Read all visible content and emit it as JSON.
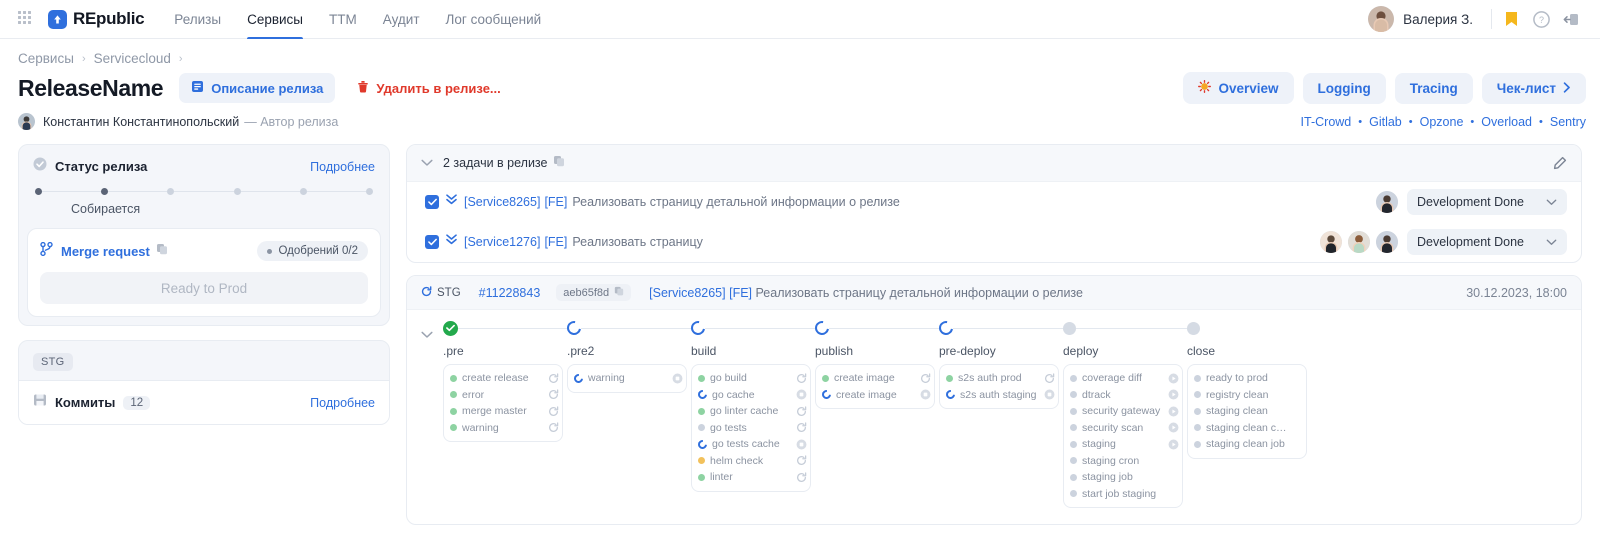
{
  "topnav": {
    "grid_icon": "apps-grid-icon",
    "brand": "REpublic",
    "links": [
      {
        "label": "Релизы",
        "active": false
      },
      {
        "label": "Сервисы",
        "active": true
      },
      {
        "label": "TTM",
        "active": false
      },
      {
        "label": "Аудит",
        "active": false
      },
      {
        "label": "Лог сообщений",
        "active": false
      }
    ],
    "user": "Валерия З.",
    "icons": [
      "bookmark-icon",
      "help-icon",
      "logout-icon"
    ]
  },
  "breadcrumb": {
    "items": [
      "Сервисы",
      "Servicecloud"
    ],
    "separator": "›"
  },
  "title": {
    "name": "ReleaseName",
    "description_button": "Описание релиза",
    "delete_button": "Удалить в релизе...",
    "tabs": [
      {
        "label": "Overview",
        "icon": "sun-icon"
      },
      {
        "label": "Logging",
        "icon": ""
      },
      {
        "label": "Tracing",
        "icon": ""
      },
      {
        "label": "Чек-лист",
        "icon": "chevron-right-icon"
      }
    ]
  },
  "author": {
    "name": "Константин Константинопольский",
    "role": "— Автор релиза",
    "links": [
      "IT-Crowd",
      "Gitlab",
      "Opzone",
      "Overload",
      "Sentry"
    ],
    "separator": "•"
  },
  "status_card": {
    "title": "Статус релиза",
    "more": "Подробнее",
    "progress_nodes": [
      true,
      true,
      false,
      false,
      false,
      false
    ],
    "progress_label": "Собирается",
    "merge_request": "Merge request",
    "approvals": "Одобрений 0/2",
    "ready_button": "Ready to Prod"
  },
  "commits_card": {
    "tag": "STG",
    "title": "Коммиты",
    "count": "12",
    "more": "Подробнее"
  },
  "tasks": {
    "header": "2 задачи в релизе",
    "edit_icon": "pencil-icon",
    "rows": [
      {
        "key": "[Service8265]",
        "fe": "[FE]",
        "text": "Реализовать страницу детальной информации о релизе",
        "avatars": 1,
        "status": "Development Done"
      },
      {
        "key": "[Service1276]",
        "fe": "[FE]",
        "text": "Реализовать страницу",
        "avatars": 3,
        "status": "Development Done"
      }
    ]
  },
  "pipeline": {
    "env": "STG",
    "id": "#11228843",
    "sha": "aeb65f8d",
    "task_key": "[Service8265]",
    "task_fe": "[FE]",
    "task_text": "Реализовать страницу детальной информации о релизе",
    "date": "30.12.2023, 18:00",
    "stages": [
      {
        "label": ".pre",
        "state": "success",
        "jobs": [
          {
            "name": "create release",
            "status": "green",
            "action": "retry"
          },
          {
            "name": "error",
            "status": "green",
            "action": "retry"
          },
          {
            "name": "merge master",
            "status": "green",
            "action": "retry"
          },
          {
            "name": "warning",
            "status": "green",
            "action": "retry"
          }
        ]
      },
      {
        "label": ".pre2",
        "state": "running",
        "jobs": [
          {
            "name": "warning",
            "status": "running",
            "action": "cancel"
          }
        ]
      },
      {
        "label": "build",
        "state": "running",
        "jobs": [
          {
            "name": "go build",
            "status": "green",
            "action": "retry"
          },
          {
            "name": "go cache",
            "status": "running",
            "action": "cancel"
          },
          {
            "name": "go linter cache",
            "status": "green",
            "action": "retry"
          },
          {
            "name": "go tests",
            "status": "grey",
            "action": "retry"
          },
          {
            "name": "go tests cache",
            "status": "running",
            "action": "cancel"
          },
          {
            "name": "helm check",
            "status": "amber",
            "action": "retry"
          },
          {
            "name": "linter",
            "status": "green",
            "action": "retry"
          }
        ]
      },
      {
        "label": "publish",
        "state": "running",
        "jobs": [
          {
            "name": "create image",
            "status": "green",
            "action": "retry"
          },
          {
            "name": "create image",
            "status": "running",
            "action": "cancel"
          }
        ]
      },
      {
        "label": "pre-deploy",
        "state": "running",
        "jobs": [
          {
            "name": "s2s auth prod",
            "status": "green",
            "action": "retry"
          },
          {
            "name": "s2s auth staging",
            "status": "running",
            "action": "cancel"
          }
        ]
      },
      {
        "label": "deploy",
        "state": "idle",
        "jobs": [
          {
            "name": "coverage diff",
            "status": "grey",
            "action": "play"
          },
          {
            "name": "dtrack",
            "status": "grey",
            "action": "play"
          },
          {
            "name": "security gateway",
            "status": "grey",
            "action": "play"
          },
          {
            "name": "security scan",
            "status": "grey",
            "action": "play"
          },
          {
            "name": "staging",
            "status": "grey",
            "action": "play"
          },
          {
            "name": "staging cron",
            "status": "grey",
            "action": ""
          },
          {
            "name": "staging job",
            "status": "grey",
            "action": ""
          },
          {
            "name": "start job staging",
            "status": "grey",
            "action": ""
          }
        ]
      },
      {
        "label": "close",
        "state": "idle",
        "jobs": [
          {
            "name": "ready to prod",
            "status": "grey",
            "action": ""
          },
          {
            "name": "registry clean",
            "status": "grey",
            "action": ""
          },
          {
            "name": "staging clean",
            "status": "grey",
            "action": ""
          },
          {
            "name": "staging clean cron",
            "status": "grey",
            "action": ""
          },
          {
            "name": "staging clean job",
            "status": "grey",
            "action": ""
          }
        ]
      }
    ]
  }
}
